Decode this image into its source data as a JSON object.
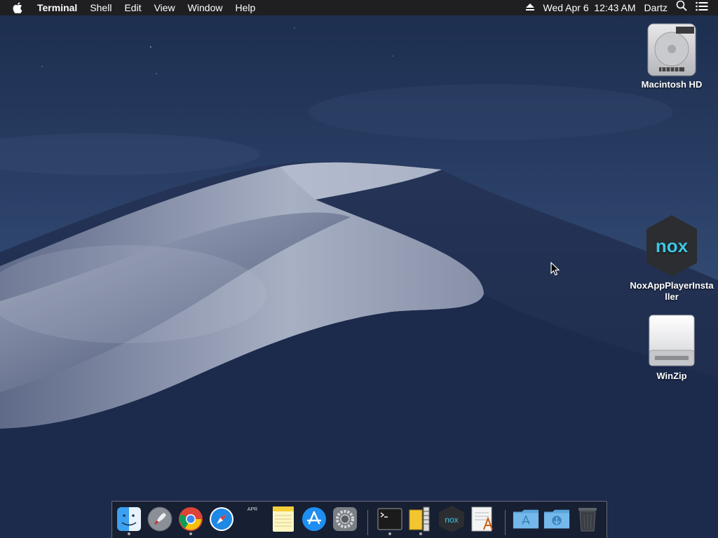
{
  "menubar": {
    "app_name": "Terminal",
    "menus": [
      "Shell",
      "Edit",
      "View",
      "Window",
      "Help"
    ],
    "datetime": "Wed Apr 6  12:43 AM",
    "user": "Dartz"
  },
  "desktop_icons": {
    "hd": "Macintosh HD",
    "nox": "NoxAppPlayerInstaller",
    "winzip": "WinZip"
  },
  "dock": {
    "calendar_month": "APR",
    "nox_label": "nox",
    "items": [
      "Finder",
      "Launchpad",
      "Google Chrome",
      "Safari",
      "Calendar",
      "Notes",
      "App Store",
      "System Preferences",
      "Terminal",
      "WinZip",
      "NoxAppPlayer",
      "TextEdit",
      "Applications",
      "Downloads",
      "Trash"
    ]
  },
  "colors": {
    "menubar_bg": "#1f1f22",
    "sky_top": "#23375c",
    "dune_light": "#9aa3b8"
  }
}
